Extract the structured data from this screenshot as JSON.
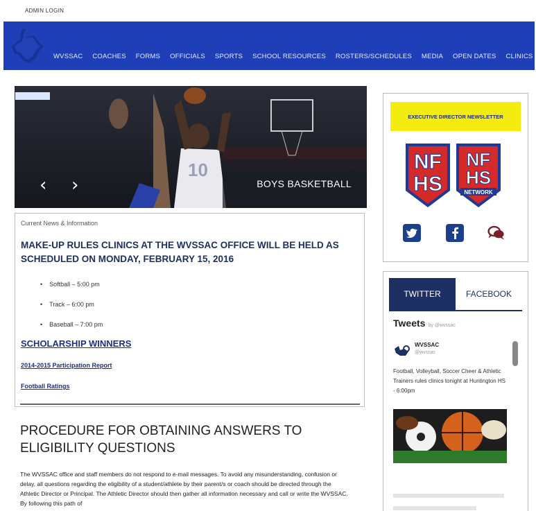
{
  "top": {
    "admin_login": "ADMIN LOGIN"
  },
  "nav": {
    "items": [
      "WVSSAC",
      "COACHES",
      "FORMS",
      "OFFICIALS",
      "SPORTS",
      "SCHOOL RESOURCES",
      "ROSTERS/SCHEDULES",
      "MEDIA",
      "OPEN DATES",
      "CLINICS"
    ]
  },
  "slider": {
    "caption": "BOYS BASKETBALL",
    "prev_icon": "chevron-left-icon",
    "next_icon": "chevron-right-icon"
  },
  "news": {
    "label": "Current News & Information",
    "headline": "MAKE-UP RULES CLINICS AT THE WVSSAC OFFICE WILL BE HELD AS SCHEDULED ON MONDAY, FEBRUARY 15, 2016",
    "schedule": [
      "Softball – 5:00 pm",
      "Track – 6:00 pm",
      "Baseball – 7:00 pm"
    ],
    "link_scholarship": "SCHOLARSHIP WINNERS",
    "link_participation": "2014-2015 Participation Report",
    "link_football": "Football Ratings"
  },
  "procedure": {
    "title": "PROCEDURE FOR OBTAINING ANSWERS TO ELIGIBILITY QUESTIONS",
    "text": "The WVSSAC office and staff members do not respond to e-mail messages. To avoid any misunderstanding, confusion or delay, all questions regarding the eligibility of a student/athlete by their parent/s or coach should be directed through the Athletic Director or Principal. The Athletic Director should then gather all information necessary and call or write the WVSSAC. By following this path of"
  },
  "sidebar": {
    "newsletter": "EXECUTIVE DIRECTOR NEWSLETTER",
    "nfhs_a": {
      "line1": "NF",
      "line2": "HS"
    },
    "nfhs_b": {
      "line1": "NF",
      "line2": "HS",
      "line3": "NETWORK"
    },
    "social_icons": [
      "twitter-icon",
      "facebook-icon",
      "chat-icon"
    ]
  },
  "feed": {
    "tab_twitter": "TWITTER",
    "tab_facebook": "FACEBOOK",
    "tweets_title": "Tweets",
    "tweets_by": "by @wvssac",
    "tweet_name": "WVSSAC",
    "tweet_handle": "@wvssac",
    "tweet_text": "Football, Volleyball, Soccer Cheer & Athletic Trainers rules clinics tonight at Huntington HS - 6:00pm"
  },
  "colors": {
    "header_blue": "#1f3fb8",
    "navy": "#1e2f63",
    "newsletter_yellow": "#f4ec10",
    "nfhs_red": "#d42a2a"
  }
}
